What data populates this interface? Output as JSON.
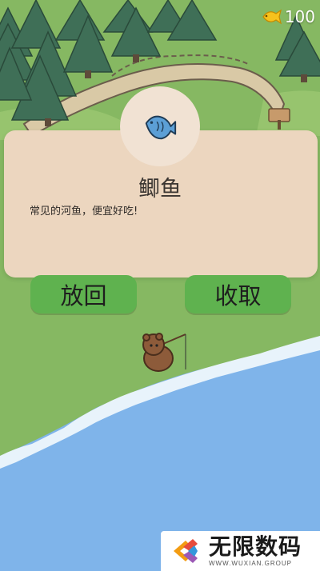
{
  "hud": {
    "coins": "100",
    "coin_icon": "gold-fish-icon"
  },
  "catch_popup": {
    "fish_icon": "blue-fish-icon",
    "fish_name": "鲫鱼",
    "description": "常见的河鱼，便宜好吃!"
  },
  "actions": {
    "release_label": "放回",
    "collect_label": "收取"
  },
  "watermark": {
    "title": "无限数码",
    "subtitle": "WWW.WUXIAN.GROUP"
  },
  "colors": {
    "card": "#ecd6bf",
    "button": "#5fb24f",
    "water": "#7fb4ea",
    "grass": "#86b862",
    "fish": "#5c9fd6"
  }
}
